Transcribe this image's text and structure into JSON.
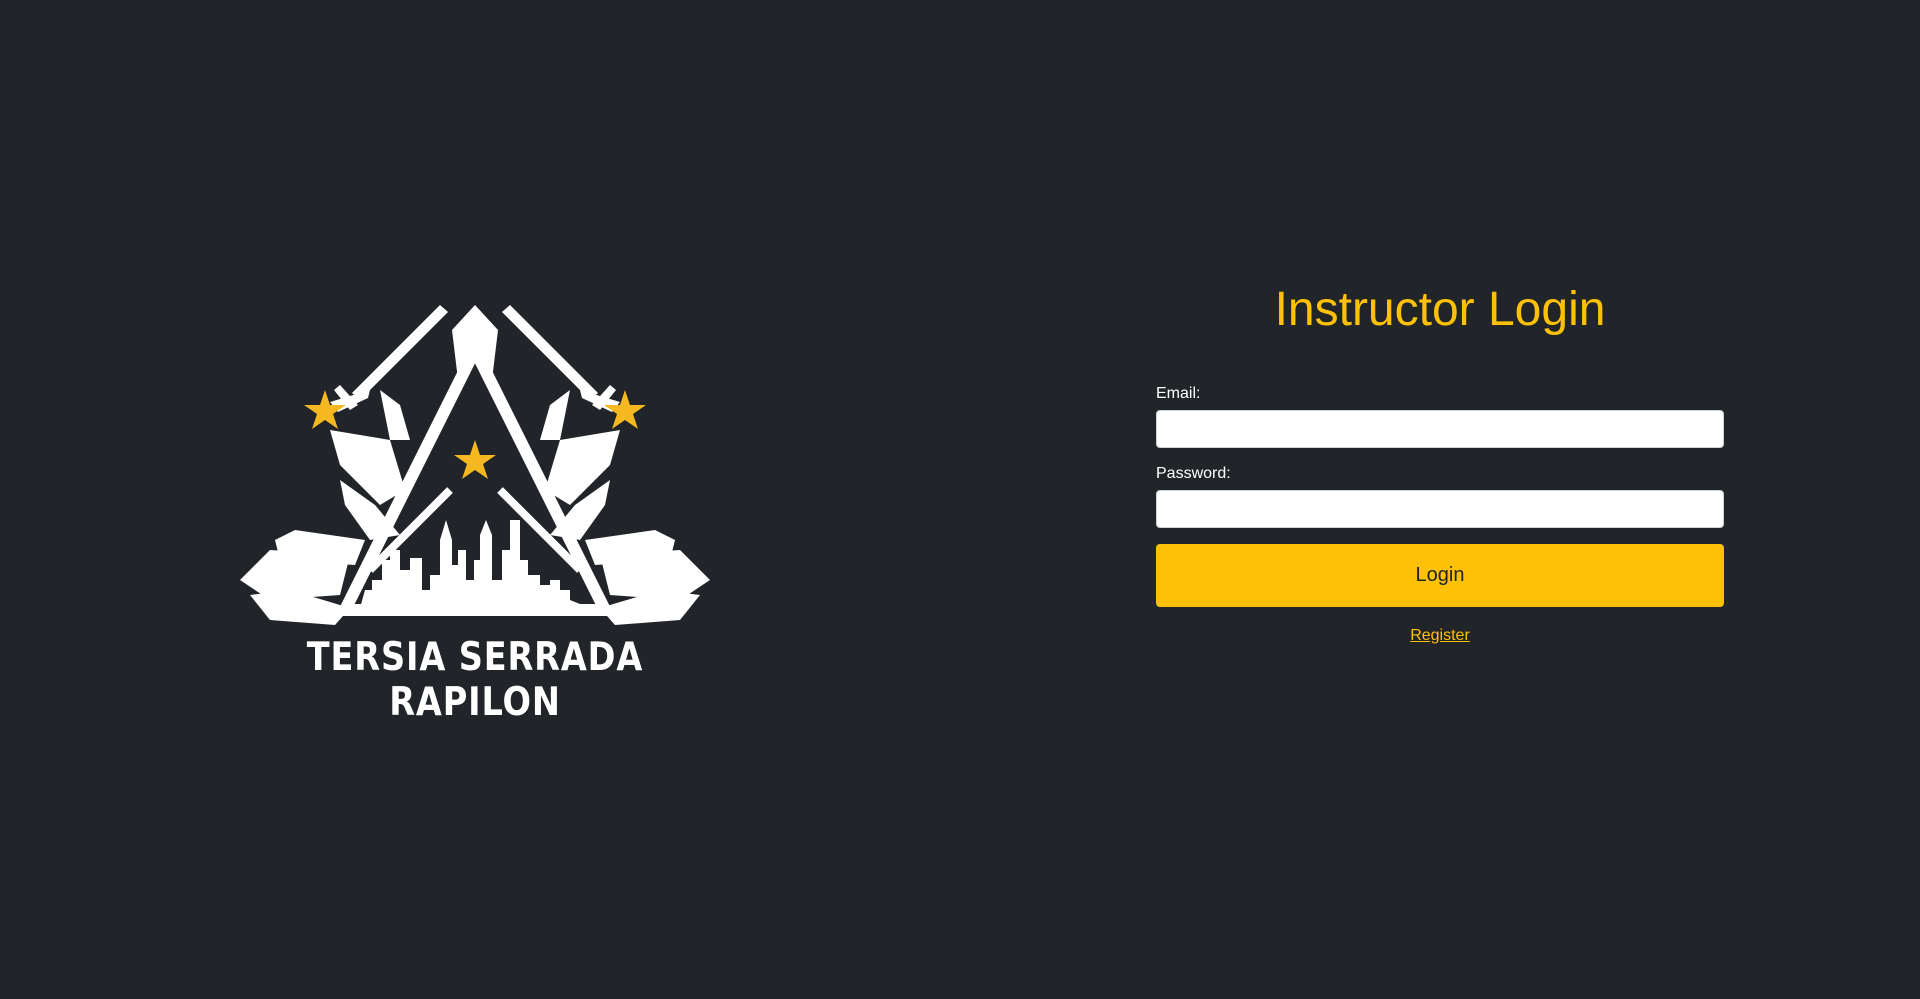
{
  "logo": {
    "wordmark": "TERSIA SERRADA RAPILON",
    "colors": {
      "primary": "#ffffff",
      "star": "#f5b820",
      "background": "#212529"
    }
  },
  "login": {
    "title": "Instructor Login",
    "email_label": "Email:",
    "email_value": "",
    "password_label": "Password:",
    "password_value": "",
    "submit_label": "Login",
    "register_label": "Register"
  },
  "theme": {
    "accent": "#ffc107",
    "background": "#212529",
    "text": "#ffffff"
  }
}
